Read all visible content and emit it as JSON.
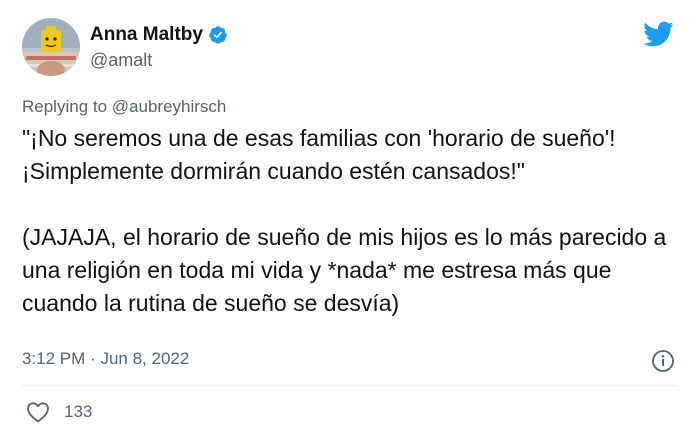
{
  "author": {
    "display_name": "Anna Maltby",
    "handle": "@amalt",
    "verified": true,
    "avatar_icon": "avatar-photo"
  },
  "reply": {
    "prefix": "Replying to",
    "mention": "@aubreyhirsch"
  },
  "tweet": {
    "paragraph1": "\"¡No seremos una de esas familias con 'horario de sueño'! ¡Simplemente dormirán cuando estén cansados!\"",
    "paragraph2": "(JAJAJA, el horario de sueño de mis hijos es lo más parecido a una religión en toda mi vida y *nada* me estresa más que cuando la rutina de sueño se desvía)"
  },
  "meta": {
    "time": "3:12 PM",
    "separator": "·",
    "date": "Jun 8, 2022"
  },
  "stats": {
    "likes": "133"
  },
  "colors": {
    "brand": "#1d9bf0",
    "text": "#0f1419",
    "secondary": "#536471"
  },
  "icons": {
    "platform": "twitter-bird-icon",
    "verified": "verified-badge-icon",
    "info": "info-icon",
    "like": "heart-icon"
  }
}
